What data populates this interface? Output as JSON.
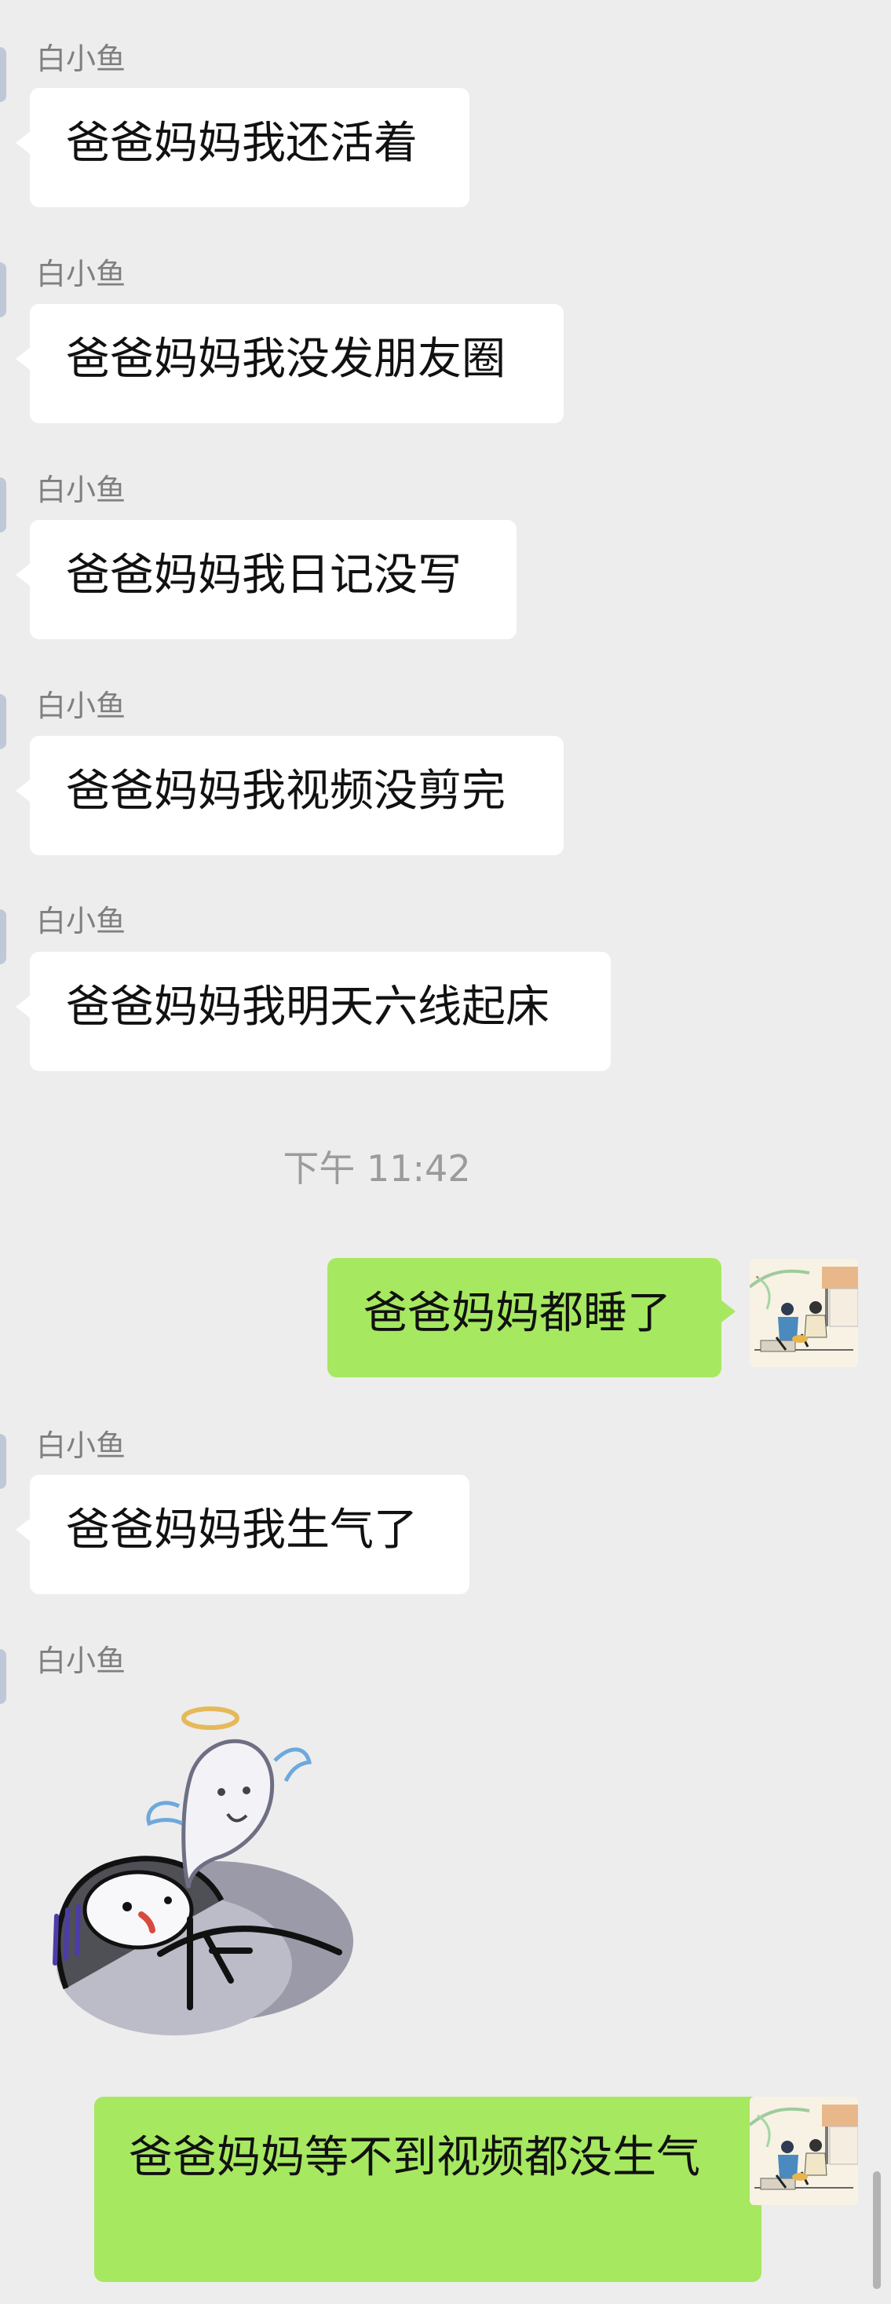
{
  "chat": {
    "sender_name": "白小鱼",
    "timestamp": "下午 11:42",
    "messages": [
      {
        "text": "爸爸妈妈我还活着"
      },
      {
        "text": "爸爸妈妈我没发朋友圈"
      },
      {
        "text": "爸爸妈妈我日记没写"
      },
      {
        "text": "爸爸妈妈我视频没剪完"
      },
      {
        "text": "爸爸妈妈我明天六线起床"
      },
      {
        "text": "爸爸妈妈都睡了"
      },
      {
        "text": "爸爸妈妈我生气了"
      },
      {
        "text": "爸爸妈妈等不到视频都没生气"
      }
    ],
    "colors": {
      "background": "#ededed",
      "incoming_bubble": "#ffffff",
      "outgoing_bubble": "#a6e860",
      "sender_name": "#7f7f7f",
      "timestamp": "#9b9b9b"
    }
  }
}
